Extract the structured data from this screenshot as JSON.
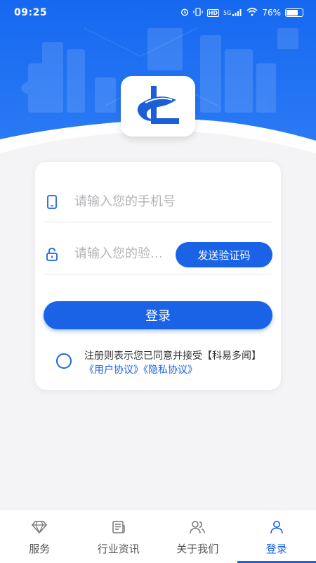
{
  "status_bar": {
    "time": "09:25",
    "network": "5G",
    "hd": "HD",
    "battery_text": "76%",
    "battery_level": 0.76
  },
  "login": {
    "phone_placeholder": "请输入您的手机号",
    "code_placeholder": "请输入您的验证码",
    "send_code_label": "发送验证码",
    "login_label": "登录",
    "agreement_text": "注册则表示您已同意并接受【科易多闻】",
    "user_agreement_link": "《用户协议》",
    "privacy_link": "《隐私协议》"
  },
  "tabs": [
    {
      "label": "服务",
      "icon": "diamond-icon",
      "active": false
    },
    {
      "label": "行业资讯",
      "icon": "news-icon",
      "active": false
    },
    {
      "label": "关于我们",
      "icon": "users-icon",
      "active": false
    },
    {
      "label": "登录",
      "icon": "user-icon",
      "active": true
    }
  ],
  "colors": {
    "primary": "#1a63e6",
    "header_blue": "#1f6df0",
    "background": "#f4f4f6"
  }
}
